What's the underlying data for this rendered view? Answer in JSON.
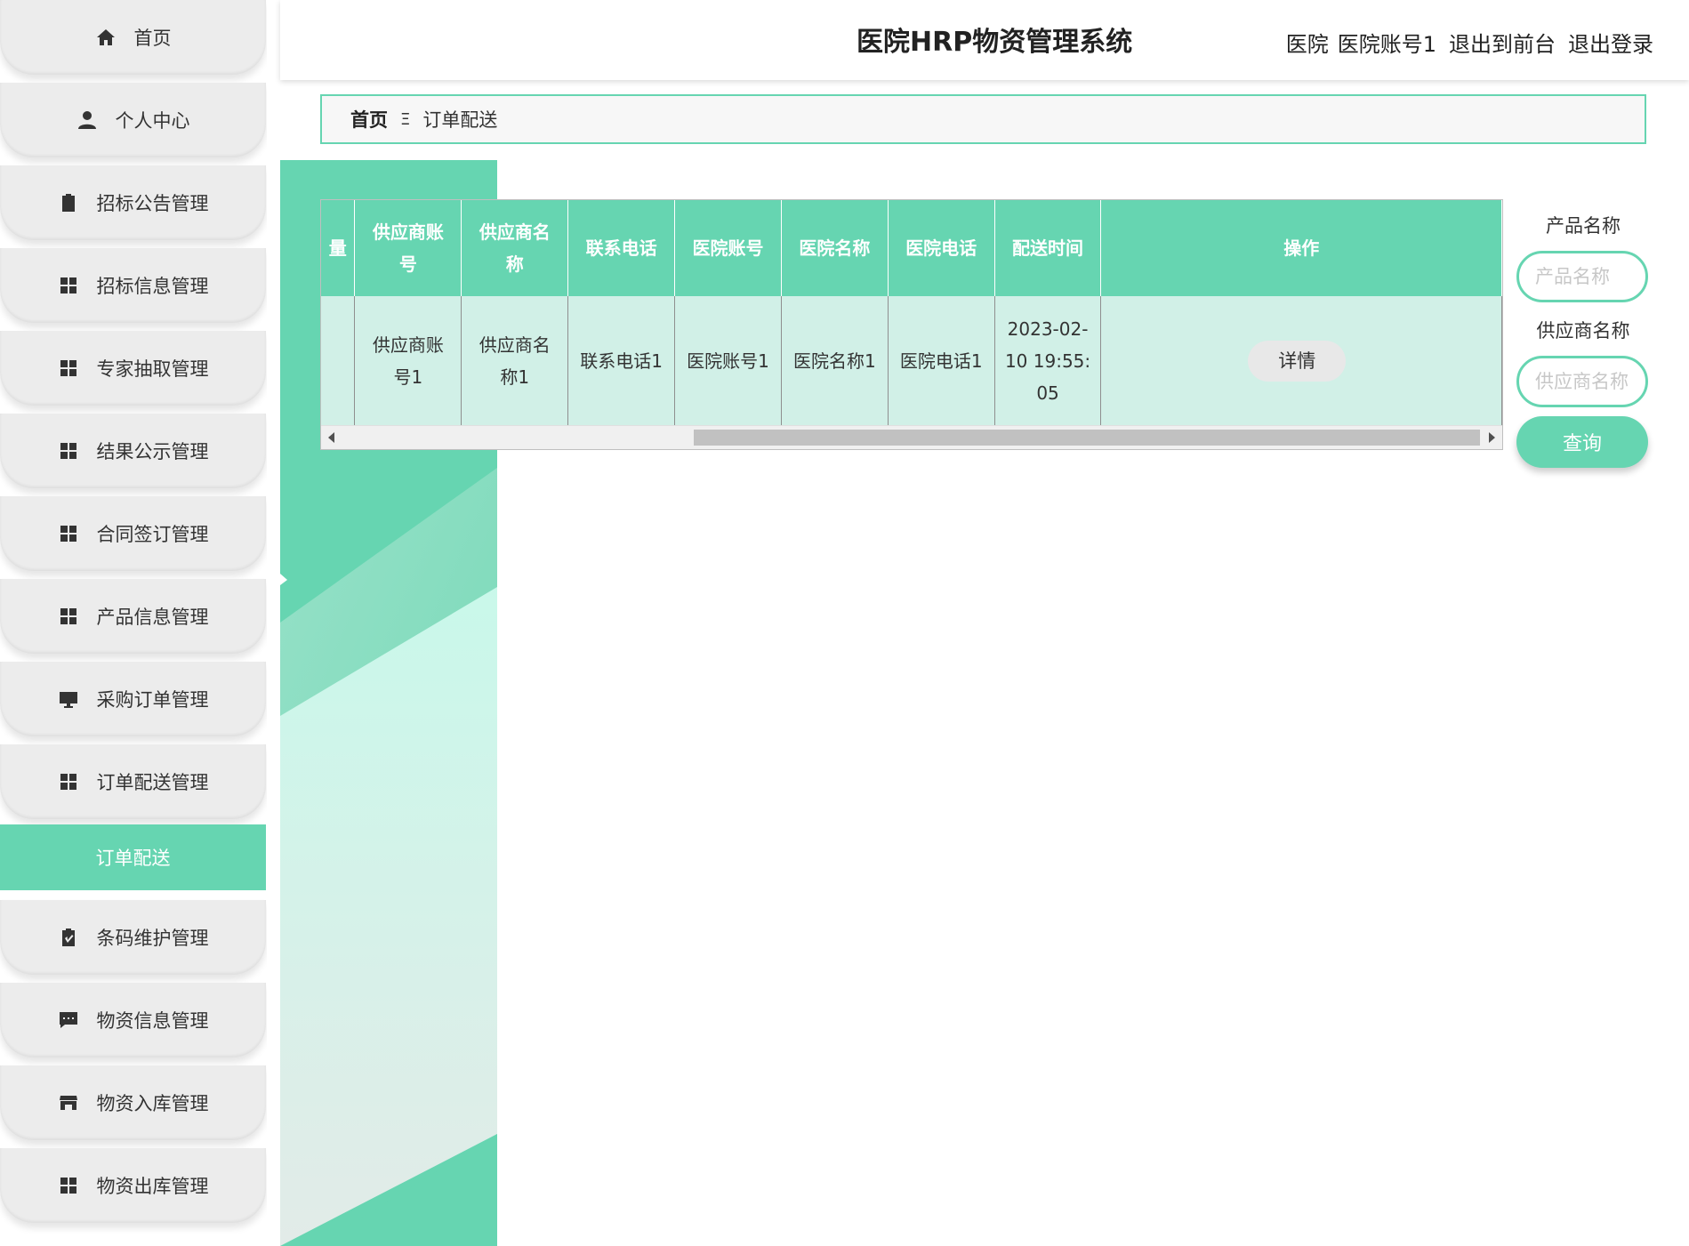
{
  "header": {
    "title": "医院HRP物资管理系统",
    "role": "医院",
    "username": "医院账号1",
    "back_to_front": "退出到前台",
    "logout": "退出登录"
  },
  "breadcrumb": {
    "home": "首页",
    "separator": "Ξ",
    "current": "订单配送"
  },
  "sidebar": {
    "items": [
      {
        "label": "首页",
        "icon": "home-icon"
      },
      {
        "label": "个人中心",
        "icon": "user-icon"
      },
      {
        "label": "招标公告管理",
        "icon": "clipboard-icon"
      },
      {
        "label": "招标信息管理",
        "icon": "grid-icon"
      },
      {
        "label": "专家抽取管理",
        "icon": "grid-icon"
      },
      {
        "label": "结果公示管理",
        "icon": "grid-icon"
      },
      {
        "label": "合同签订管理",
        "icon": "grid-icon"
      },
      {
        "label": "产品信息管理",
        "icon": "grid-icon"
      },
      {
        "label": "采购订单管理",
        "icon": "monitor-icon"
      },
      {
        "label": "订单配送管理",
        "icon": "grid-icon"
      },
      {
        "label": "条码维护管理",
        "icon": "clipboard-check-icon"
      },
      {
        "label": "物资信息管理",
        "icon": "chat-icon"
      },
      {
        "label": "物资入库管理",
        "icon": "store-icon"
      },
      {
        "label": "物资出库管理",
        "icon": "grid-icon"
      }
    ],
    "active_submenu": "订单配送"
  },
  "table": {
    "columns": [
      "量",
      "供应商账号",
      "供应商名称",
      "联系电话",
      "医院账号",
      "医院名称",
      "医院电话",
      "配送时间",
      "操作"
    ],
    "rows": [
      {
        "cells": [
          "",
          "供应商账号1",
          "供应商名称1",
          "联系电话1",
          "医院账号1",
          "医院名称1",
          "医院电话1",
          "2023-02-10 19:55:05"
        ],
        "action": "详情"
      }
    ]
  },
  "search": {
    "product_label": "产品名称",
    "product_placeholder": "产品名称",
    "supplier_label": "供应商名称",
    "supplier_placeholder": "供应商名称",
    "query_button": "查询"
  },
  "colors": {
    "accent": "#66d5b1",
    "table_row": "#d1f0e7",
    "menu_bg": "#ececec"
  }
}
